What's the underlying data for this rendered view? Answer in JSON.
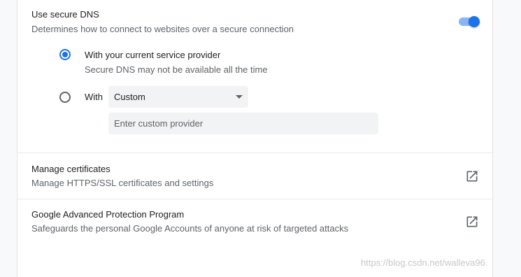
{
  "secure_dns": {
    "title": "Use secure DNS",
    "description": "Determines how to connect to websites over a secure connection",
    "enabled": true,
    "option_current": {
      "label": "With your current service provider",
      "description": "Secure DNS may not be available all the time",
      "selected": true
    },
    "option_custom": {
      "label": "With",
      "selected": false,
      "select_value": "Custom",
      "input_placeholder": "Enter custom provider",
      "input_value": ""
    }
  },
  "manage_certificates": {
    "title": "Manage certificates",
    "description": "Manage HTTPS/SSL certificates and settings",
    "icon": "open-in-new-icon"
  },
  "advanced_protection": {
    "title": "Google Advanced Protection Program",
    "description": "Safeguards the personal Google Accounts of anyone at risk of targeted attacks",
    "icon": "open-in-new-icon"
  },
  "watermark": "https://blog.csdn.net/walleva96",
  "colors": {
    "accent": "#1a73e8",
    "toggle_track": "#8ab4f8",
    "secondary_text": "#5f6368",
    "field_bg": "#f1f3f4"
  }
}
